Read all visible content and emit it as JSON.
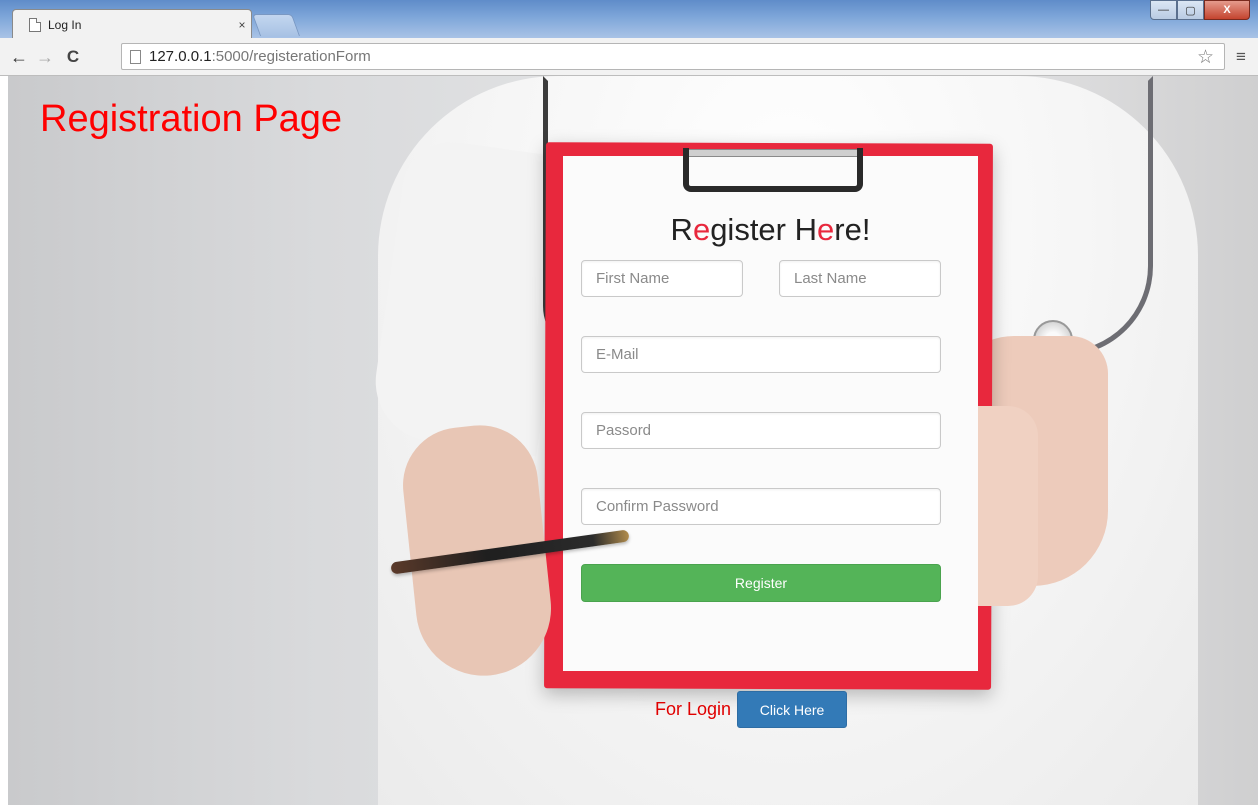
{
  "browser": {
    "tab_title": "Log In",
    "tab_close": "×",
    "url_host": "127.0.0.1",
    "url_path": ":5000/registerationForm",
    "win_buttons": {
      "minimize": "—",
      "maximize": "▢",
      "close": "X"
    }
  },
  "nav": {
    "back": "←",
    "forward": "→",
    "reload": "C",
    "star": "☆",
    "menu": "≡"
  },
  "page": {
    "heading": "Registration Page",
    "form": {
      "title_parts": [
        "R",
        "e",
        "gister H",
        "e",
        "re!"
      ],
      "fields": {
        "first_name_placeholder": "First Name",
        "last_name_placeholder": "Last Name",
        "email_placeholder": "E-Mail",
        "password_placeholder": "Passord",
        "confirm_password_placeholder": "Confirm Password"
      },
      "register_label": "Register"
    },
    "login": {
      "label": "For Login",
      "button_label": "Click Here"
    }
  },
  "colors": {
    "heading": "#ff0000",
    "clipboard": "#e8283d",
    "register_button": "#54b458",
    "click_here_button": "#337ab7"
  }
}
